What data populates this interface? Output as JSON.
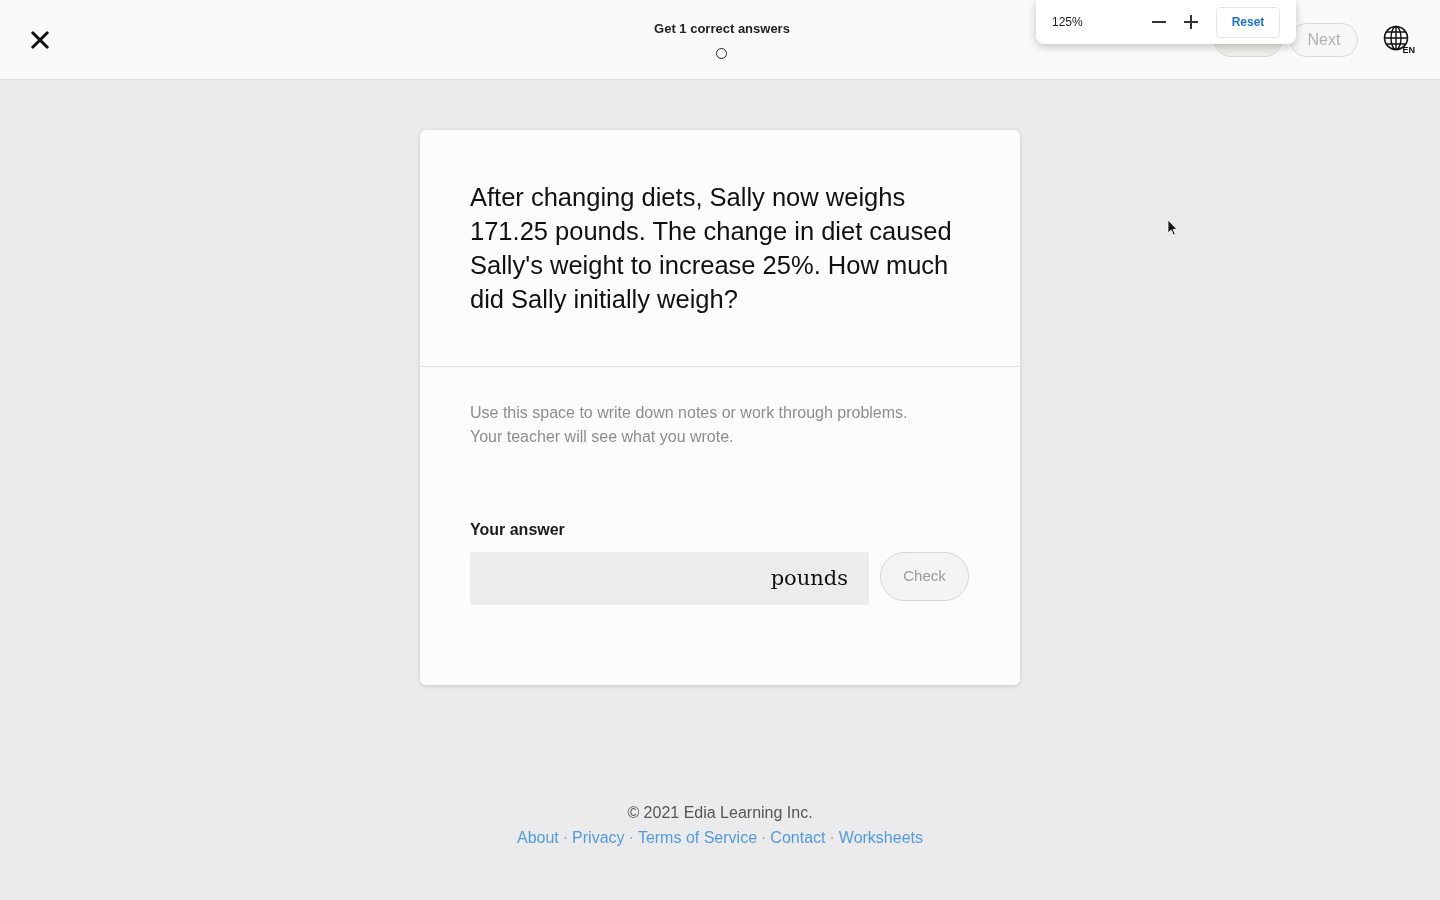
{
  "header": {
    "goal": "Get 1 correct answers",
    "progress": [
      {
        "done": false
      }
    ],
    "next_button": {
      "label": "Next",
      "disabled": true
    },
    "language": {
      "code": "EN"
    }
  },
  "zoom_popup": {
    "level": "125%",
    "reset_label": "Reset"
  },
  "question": {
    "text": "After changing diets, Sally now weighs 171.25 pounds. The change in diet caused Sally's weight to increase 25%. How much did Sally initially weigh?"
  },
  "notes": {
    "placeholder": "Use this space to write down notes or work through problems.\nYour teacher will see what you wrote."
  },
  "answer": {
    "label": "Your answer",
    "unit": "pounds",
    "check_button": {
      "label": "Check",
      "disabled": true
    }
  },
  "footer": {
    "copyright": "© 2021 Edia Learning Inc.",
    "links": [
      "About",
      "Privacy",
      "Terms of Service",
      "Contact",
      "Worksheets"
    ],
    "separator": "·"
  }
}
